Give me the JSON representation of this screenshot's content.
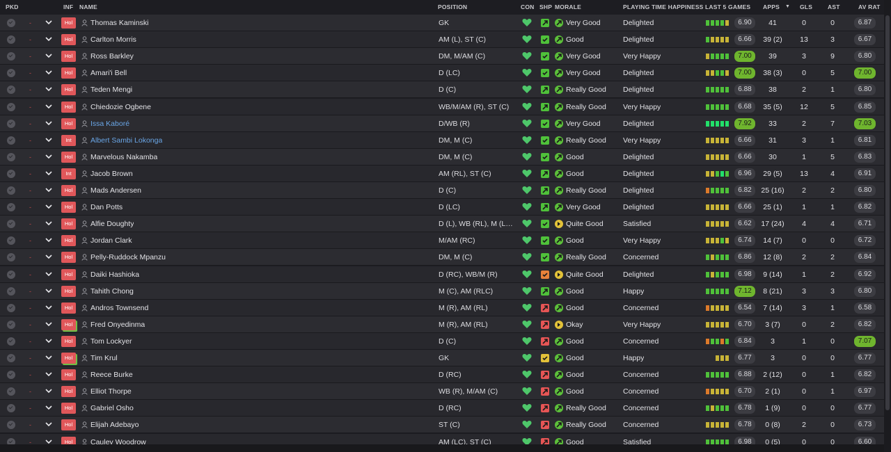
{
  "columns": {
    "pkd": "PKD",
    "inf": "INF",
    "name": "NAME",
    "position": "POSITION",
    "con": "CON",
    "shp": "SHP",
    "morale": "MORALE",
    "pth": "PLAYING TIME HAPPINESS",
    "last5": "LAST 5 GAMES",
    "apps": "APPS",
    "gls": "GLS",
    "ast": "AST",
    "avrat": "AV RAT"
  },
  "sort_indicator": "▼",
  "colors": {
    "bar_green": "#4fc13a",
    "bar_yellow": "#c8b437",
    "bar_orange": "#dc7a2a",
    "bar_bright": "#22e06a",
    "shp_green": "#4fc13a",
    "shp_yellow": "#e3c239",
    "shp_orange": "#e8823a",
    "shp_red": "#e65555",
    "mor_green": "#5cbf3a",
    "mor_lime": "#a9cc37",
    "mor_yellow": "#e3c239",
    "mor_orange": "#e8a23a",
    "con_heart": "#4ec76a",
    "inf_badge": "#e0575a",
    "name_link": "#6aa6e6"
  },
  "players": [
    {
      "inf": "Hol",
      "name": "Thomas Kaminski",
      "position": "GK",
      "shp": "green",
      "shp_icon": "up",
      "morale_color": "green",
      "morale": "Very Good",
      "pth": "Delighted",
      "bars": [
        "g",
        "g",
        "g",
        "g",
        "y"
      ],
      "last5": "6.90",
      "last5_hi": false,
      "apps": "41",
      "gls": "0",
      "ast": "0",
      "avrat": "6.87",
      "avrat_hi": false,
      "link": false,
      "inf_green": false
    },
    {
      "inf": "Hol",
      "name": "Carlton Morris",
      "position": "AM (L), ST (C)",
      "shp": "green",
      "shp_icon": "check",
      "morale_color": "green",
      "morale": "Good",
      "pth": "Delighted",
      "bars": [
        "g",
        "y",
        "y",
        "y",
        "y"
      ],
      "last5": "6.66",
      "last5_hi": false,
      "apps": "39 (2)",
      "gls": "13",
      "ast": "3",
      "avrat": "6.67",
      "avrat_hi": false,
      "link": false,
      "inf_green": false
    },
    {
      "inf": "Hol",
      "name": "Ross Barkley",
      "position": "DM, M/AM (C)",
      "shp": "green",
      "shp_icon": "check",
      "morale_color": "green",
      "morale": "Very Good",
      "pth": "Very Happy",
      "bars": [
        "y",
        "g",
        "g",
        "g",
        "g"
      ],
      "last5": "7.00",
      "last5_hi": true,
      "apps": "39",
      "gls": "3",
      "ast": "9",
      "avrat": "6.80",
      "avrat_hi": false,
      "link": false,
      "inf_green": false
    },
    {
      "inf": "Hol",
      "name": "Amari'i Bell",
      "position": "D (LC)",
      "shp": "green",
      "shp_icon": "check",
      "morale_color": "green",
      "morale": "Very Good",
      "pth": "Delighted",
      "bars": [
        "y",
        "y",
        "g",
        "g",
        "y"
      ],
      "last5": "7.00",
      "last5_hi": true,
      "apps": "38 (3)",
      "gls": "0",
      "ast": "5",
      "avrat": "7.00",
      "avrat_hi": true,
      "link": false,
      "inf_green": false
    },
    {
      "inf": "Hol",
      "name": "Teden Mengi",
      "position": "D (C)",
      "shp": "green",
      "shp_icon": "up",
      "morale_color": "green",
      "morale": "Really Good",
      "pth": "Delighted",
      "bars": [
        "g",
        "g",
        "g",
        "g",
        "g"
      ],
      "last5": "6.88",
      "last5_hi": false,
      "apps": "38",
      "gls": "2",
      "ast": "1",
      "avrat": "6.80",
      "avrat_hi": false,
      "link": false,
      "inf_green": false
    },
    {
      "inf": "Hol",
      "name": "Chiedozie Ogbene",
      "position": "WB/M/AM (R), ST (C)",
      "shp": "green",
      "shp_icon": "up",
      "morale_color": "green",
      "morale": "Really Good",
      "pth": "Very Happy",
      "bars": [
        "g",
        "g",
        "g",
        "g",
        "g"
      ],
      "last5": "6.68",
      "last5_hi": false,
      "apps": "35 (5)",
      "gls": "12",
      "ast": "5",
      "avrat": "6.85",
      "avrat_hi": false,
      "link": false,
      "inf_green": false
    },
    {
      "inf": "Hol",
      "name": "Issa Kaboré",
      "position": "D/WB (R)",
      "shp": "green",
      "shp_icon": "check",
      "morale_color": "green",
      "morale": "Very Good",
      "pth": "Delighted",
      "bars": [
        "b",
        "b",
        "b",
        "b",
        "b"
      ],
      "last5": "7.92",
      "last5_hi": true,
      "apps": "33",
      "gls": "2",
      "ast": "7",
      "avrat": "7.03",
      "avrat_hi": true,
      "link": true,
      "inf_green": false
    },
    {
      "inf": "Int",
      "name": "Albert Sambi Lokonga",
      "position": "DM, M (C)",
      "shp": "green",
      "shp_icon": "check",
      "morale_color": "green",
      "morale": "Really Good",
      "pth": "Very Happy",
      "bars": [
        "y",
        "y",
        "y",
        "y",
        "y"
      ],
      "last5": "6.66",
      "last5_hi": false,
      "apps": "31",
      "gls": "3",
      "ast": "1",
      "avrat": "6.81",
      "avrat_hi": false,
      "link": true,
      "inf_green": false
    },
    {
      "inf": "Hol",
      "name": "Marvelous Nakamba",
      "position": "DM, M (C)",
      "shp": "green",
      "shp_icon": "check",
      "morale_color": "green",
      "morale": "Good",
      "pth": "Delighted",
      "bars": [
        "y",
        "y",
        "y",
        "y",
        "y"
      ],
      "last5": "6.66",
      "last5_hi": false,
      "apps": "30",
      "gls": "1",
      "ast": "5",
      "avrat": "6.83",
      "avrat_hi": false,
      "link": false,
      "inf_green": false
    },
    {
      "inf": "Int",
      "name": "Jacob Brown",
      "position": "AM (RL), ST (C)",
      "shp": "green",
      "shp_icon": "up",
      "morale_color": "green",
      "morale": "Good",
      "pth": "Delighted",
      "bars": [
        "y",
        "y",
        "g",
        "b",
        "g"
      ],
      "last5": "6.96",
      "last5_hi": false,
      "apps": "29 (5)",
      "gls": "13",
      "ast": "4",
      "avrat": "6.91",
      "avrat_hi": false,
      "link": false,
      "inf_green": false
    },
    {
      "inf": "Hol",
      "name": "Mads Andersen",
      "position": "D (C)",
      "shp": "green",
      "shp_icon": "up",
      "morale_color": "green",
      "morale": "Really Good",
      "pth": "Delighted",
      "bars": [
        "o",
        "g",
        "g",
        "g",
        "g"
      ],
      "last5": "6.82",
      "last5_hi": false,
      "apps": "25 (16)",
      "gls": "2",
      "ast": "2",
      "avrat": "6.80",
      "avrat_hi": false,
      "link": false,
      "inf_green": false
    },
    {
      "inf": "Hol",
      "name": "Dan Potts",
      "position": "D (LC)",
      "shp": "green",
      "shp_icon": "up",
      "morale_color": "green",
      "morale": "Very Good",
      "pth": "Delighted",
      "bars": [
        "y",
        "y",
        "y",
        "y",
        "y"
      ],
      "last5": "6.66",
      "last5_hi": false,
      "apps": "25 (1)",
      "gls": "1",
      "ast": "1",
      "avrat": "6.82",
      "avrat_hi": false,
      "link": false,
      "inf_green": false
    },
    {
      "inf": "Hol",
      "name": "Alfie Doughty",
      "position": "D (L), WB (RL), M (L),...",
      "shp": "green",
      "shp_icon": "check",
      "morale_color": "yellow",
      "morale": "Quite Good",
      "pth": "Satisfied",
      "bars": [
        "y",
        "y",
        "y",
        "y",
        "y"
      ],
      "last5": "6.62",
      "last5_hi": false,
      "apps": "17 (24)",
      "gls": "4",
      "ast": "4",
      "avrat": "6.71",
      "avrat_hi": false,
      "link": false,
      "inf_green": false
    },
    {
      "inf": "Hol",
      "name": "Jordan Clark",
      "position": "M/AM (RC)",
      "shp": "green",
      "shp_icon": "check",
      "morale_color": "green",
      "morale": "Good",
      "pth": "Very Happy",
      "bars": [
        "y",
        "y",
        "y",
        "g",
        "y"
      ],
      "last5": "6.74",
      "last5_hi": false,
      "apps": "14 (7)",
      "gls": "0",
      "ast": "0",
      "avrat": "6.72",
      "avrat_hi": false,
      "link": false,
      "inf_green": false
    },
    {
      "inf": "Hol",
      "name": "Pelly-Ruddock Mpanzu",
      "position": "DM, M (C)",
      "shp": "green",
      "shp_icon": "check",
      "morale_color": "green",
      "morale": "Really Good",
      "pth": "Concerned",
      "bars": [
        "g",
        "y",
        "g",
        "g",
        "g"
      ],
      "last5": "6.86",
      "last5_hi": false,
      "apps": "12 (8)",
      "gls": "2",
      "ast": "2",
      "avrat": "6.84",
      "avrat_hi": false,
      "link": false,
      "inf_green": false
    },
    {
      "inf": "Hol",
      "name": "Daiki Hashioka",
      "position": "D (RC), WB/M (R)",
      "shp": "orange",
      "shp_icon": "check",
      "morale_color": "yellow",
      "morale": "Quite Good",
      "pth": "Delighted",
      "bars": [
        "g",
        "y",
        "g",
        "g",
        "g"
      ],
      "last5": "6.98",
      "last5_hi": false,
      "apps": "9 (14)",
      "gls": "1",
      "ast": "2",
      "avrat": "6.92",
      "avrat_hi": false,
      "link": false,
      "inf_green": false
    },
    {
      "inf": "Hol",
      "name": "Tahith Chong",
      "position": "M (C), AM (RLC)",
      "shp": "green",
      "shp_icon": "up",
      "morale_color": "green",
      "morale": "Good",
      "pth": "Happy",
      "bars": [
        "g",
        "g",
        "g",
        "g",
        "g"
      ],
      "last5": "7.12",
      "last5_hi": true,
      "apps": "8 (21)",
      "gls": "3",
      "ast": "3",
      "avrat": "6.80",
      "avrat_hi": false,
      "link": false,
      "inf_green": false
    },
    {
      "inf": "Hol",
      "name": "Andros Townsend",
      "position": "M (R), AM (RL)",
      "shp": "red",
      "shp_icon": "up",
      "morale_color": "green",
      "morale": "Good",
      "pth": "Concerned",
      "bars": [
        "o",
        "y",
        "y",
        "y",
        "y"
      ],
      "last5": "6.54",
      "last5_hi": false,
      "apps": "7 (14)",
      "gls": "3",
      "ast": "1",
      "avrat": "6.58",
      "avrat_hi": false,
      "link": false,
      "inf_green": false
    },
    {
      "inf": "Hol",
      "name": "Fred Onyedinma",
      "position": "M (R), AM (RL)",
      "shp": "red",
      "shp_icon": "up",
      "morale_color": "yellow",
      "morale": "Okay",
      "pth": "Very Happy",
      "bars": [
        "y",
        "y",
        "y",
        "y",
        "y"
      ],
      "last5": "6.70",
      "last5_hi": false,
      "apps": "3 (7)",
      "gls": "0",
      "ast": "2",
      "avrat": "6.82",
      "avrat_hi": false,
      "link": false,
      "inf_green": true
    },
    {
      "inf": "Hol",
      "name": "Tom Lockyer",
      "position": "D (C)",
      "shp": "red",
      "shp_icon": "up",
      "morale_color": "green",
      "morale": "Good",
      "pth": "Concerned",
      "bars": [
        "o",
        "g",
        "g",
        "o",
        "g"
      ],
      "last5": "6.84",
      "last5_hi": false,
      "apps": "3",
      "gls": "1",
      "ast": "0",
      "avrat": "7.07",
      "avrat_hi": true,
      "link": false,
      "inf_green": false
    },
    {
      "inf": "Hol",
      "name": "Tim Krul",
      "position": "GK",
      "shp": "yellow",
      "shp_icon": "check",
      "morale_color": "green",
      "morale": "Good",
      "pth": "Happy",
      "bars": [
        "n",
        "n",
        "y",
        "y",
        "y"
      ],
      "last5": "6.77",
      "last5_hi": false,
      "apps": "3",
      "gls": "0",
      "ast": "0",
      "avrat": "6.77",
      "avrat_hi": false,
      "link": false,
      "inf_green": true
    },
    {
      "inf": "Hol",
      "name": "Reece Burke",
      "position": "D (RC)",
      "shp": "red",
      "shp_icon": "up",
      "morale_color": "green",
      "morale": "Good",
      "pth": "Concerned",
      "bars": [
        "g",
        "g",
        "g",
        "g",
        "g"
      ],
      "last5": "6.88",
      "last5_hi": false,
      "apps": "2 (12)",
      "gls": "0",
      "ast": "1",
      "avrat": "6.82",
      "avrat_hi": false,
      "link": false,
      "inf_green": false
    },
    {
      "inf": "Hol",
      "name": "Elliot Thorpe",
      "position": "WB (R), M/AM (C)",
      "shp": "red",
      "shp_icon": "up",
      "morale_color": "green",
      "morale": "Good",
      "pth": "Concerned",
      "bars": [
        "o",
        "y",
        "y",
        "y",
        "y"
      ],
      "last5": "6.70",
      "last5_hi": false,
      "apps": "2 (1)",
      "gls": "0",
      "ast": "1",
      "avrat": "6.97",
      "avrat_hi": false,
      "link": false,
      "inf_green": false
    },
    {
      "inf": "Hol",
      "name": "Gabriel Osho",
      "position": "D (RC)",
      "shp": "red",
      "shp_icon": "up",
      "morale_color": "green",
      "morale": "Really Good",
      "pth": "Concerned",
      "bars": [
        "g",
        "y",
        "g",
        "g",
        "g"
      ],
      "last5": "6.78",
      "last5_hi": false,
      "apps": "1 (9)",
      "gls": "0",
      "ast": "0",
      "avrat": "6.77",
      "avrat_hi": false,
      "link": false,
      "inf_green": false
    },
    {
      "inf": "Hol",
      "name": "Elijah Adebayo",
      "position": "ST (C)",
      "shp": "red",
      "shp_icon": "up",
      "morale_color": "green",
      "morale": "Really Good",
      "pth": "Concerned",
      "bars": [
        "y",
        "y",
        "y",
        "y",
        "y"
      ],
      "last5": "6.78",
      "last5_hi": false,
      "apps": "0 (8)",
      "gls": "2",
      "ast": "0",
      "avrat": "6.73",
      "avrat_hi": false,
      "link": false,
      "inf_green": false
    },
    {
      "inf": "Hol",
      "name": "Cauley Woodrow",
      "position": "AM (LC), ST (C)",
      "shp": "red",
      "shp_icon": "up",
      "morale_color": "green",
      "morale": "Good",
      "pth": "Satisfied",
      "bars": [
        "g",
        "g",
        "g",
        "g",
        "g"
      ],
      "last5": "6.98",
      "last5_hi": false,
      "apps": "0 (5)",
      "gls": "0",
      "ast": "0",
      "avrat": "6.60",
      "avrat_hi": false,
      "link": false,
      "inf_green": false
    }
  ]
}
